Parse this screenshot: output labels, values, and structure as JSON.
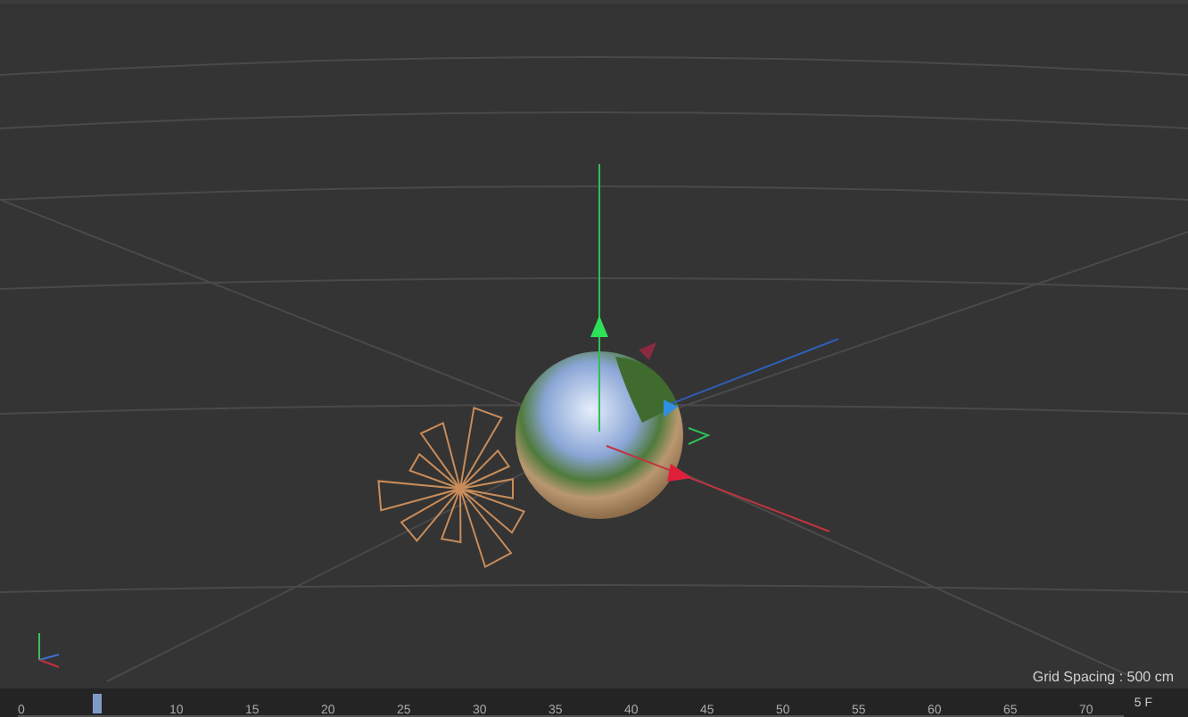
{
  "viewport": {
    "grid_spacing": "Grid Spacing : 500 cm"
  },
  "timeline": {
    "ticks": [
      "0",
      "10",
      "15",
      "20",
      "25",
      "30",
      "35",
      "40",
      "45",
      "50",
      "55",
      "60",
      "65",
      "70"
    ],
    "playhead": {
      "level": 0.0667
    },
    "current_frame": "5 F"
  }
}
